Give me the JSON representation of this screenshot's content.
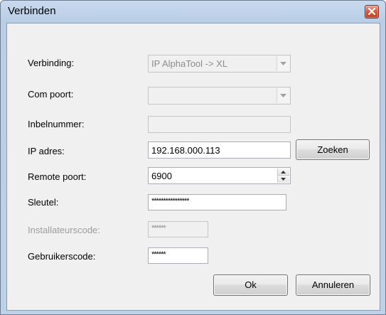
{
  "window": {
    "title": "Verbinden"
  },
  "form": {
    "verbinding_label": "Verbinding:",
    "verbinding_value": "IP AlphaTool -> XL",
    "com_poort_label": "Com poort:",
    "com_poort_value": "",
    "inbelnummer_label": "Inbelnummer:",
    "inbelnummer_value": "",
    "ip_adres_label": "IP adres:",
    "ip_adres_value": "192.168.000.113",
    "remote_poort_label": "Remote poort:",
    "remote_poort_value": "6900",
    "sleutel_label": "Sleutel:",
    "sleutel_value": "****************",
    "installateurscode_label": "Installateurscode:",
    "installateurscode_value": "******",
    "gebruikerscode_label": "Gebruikerscode:",
    "gebruikerscode_value": "******"
  },
  "buttons": {
    "zoeken": "Zoeken",
    "ok": "Ok",
    "annuleren": "Annuleren"
  },
  "icons": {
    "close": "close-icon",
    "dropdown": "chevron-down-icon",
    "spin_up": "spin-up-icon",
    "spin_down": "spin-down-icon"
  },
  "colors": {
    "titlebar": "#bdd1e8",
    "close_button": "#d7553a",
    "client_background": "#f0f0f0"
  }
}
